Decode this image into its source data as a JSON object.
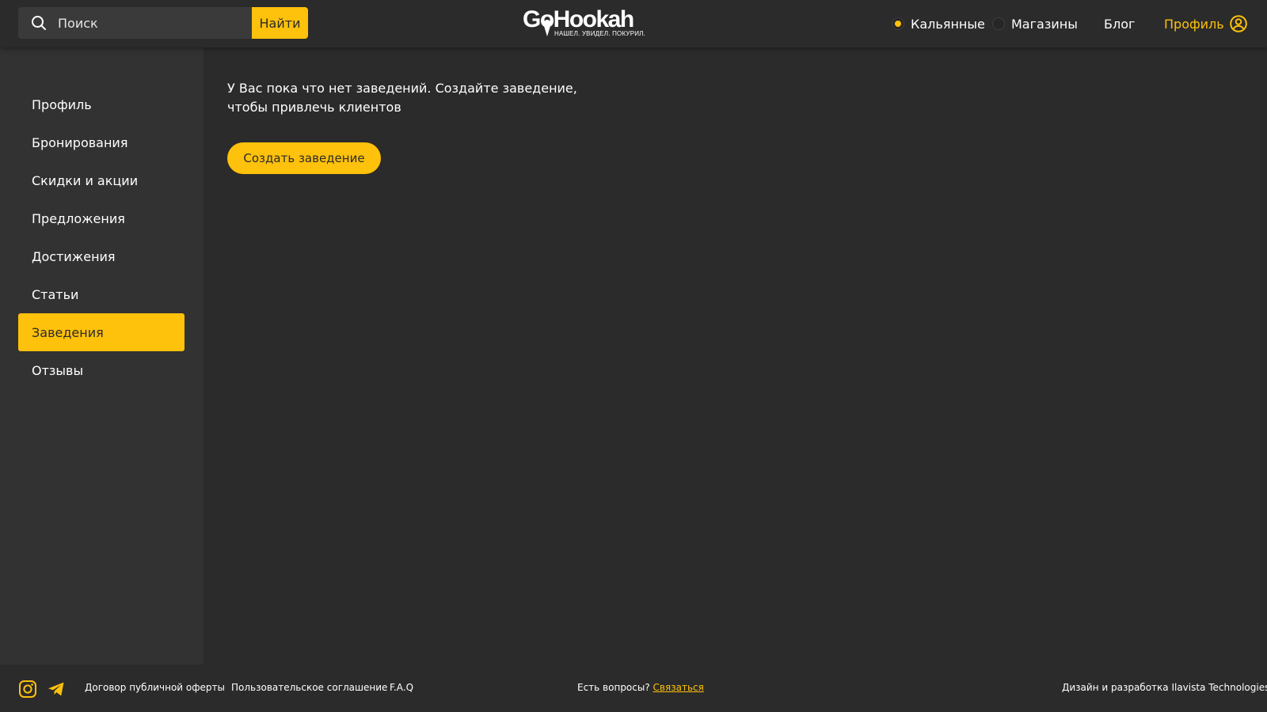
{
  "header": {
    "search": {
      "placeholder": "Поиск",
      "button_label": "Найти"
    },
    "logo": {
      "name": "GoHookah",
      "tagline": "НАШЕЛ. УВИДЕЛ. ПОКУРИЛ."
    },
    "nav": {
      "hookahs_label": "Кальянные",
      "hookahs_selected": true,
      "shops_label": "Магазины",
      "shops_selected": false,
      "blog_label": "Блог",
      "profile_label": "Профиль"
    }
  },
  "sidebar": {
    "items": [
      {
        "label": "Профиль"
      },
      {
        "label": "Бронирования"
      },
      {
        "label": "Скидки и акции"
      },
      {
        "label": "Предложения"
      },
      {
        "label": "Достижения"
      },
      {
        "label": "Статьи"
      },
      {
        "label": "Заведения",
        "active": true
      },
      {
        "label": "Отзывы"
      }
    ]
  },
  "main": {
    "empty_message": "У Вас пока что нет заведений. Создайте заведение, чтобы привлечь клиентов",
    "create_button_label": "Создать заведение"
  },
  "footer": {
    "offer_label": "Договор публичной оферты",
    "agreement_label": "Пользовательское соглашение",
    "faq_label": "F.A.Q",
    "questions_label": "Есть вопросы?",
    "contact_label": "Связаться",
    "credits_label": "Дизайн и разработка Ilavista Technologies"
  },
  "colors": {
    "accent": "#fec10c",
    "background": "#2b2b2b",
    "sidebar": "#323232"
  }
}
